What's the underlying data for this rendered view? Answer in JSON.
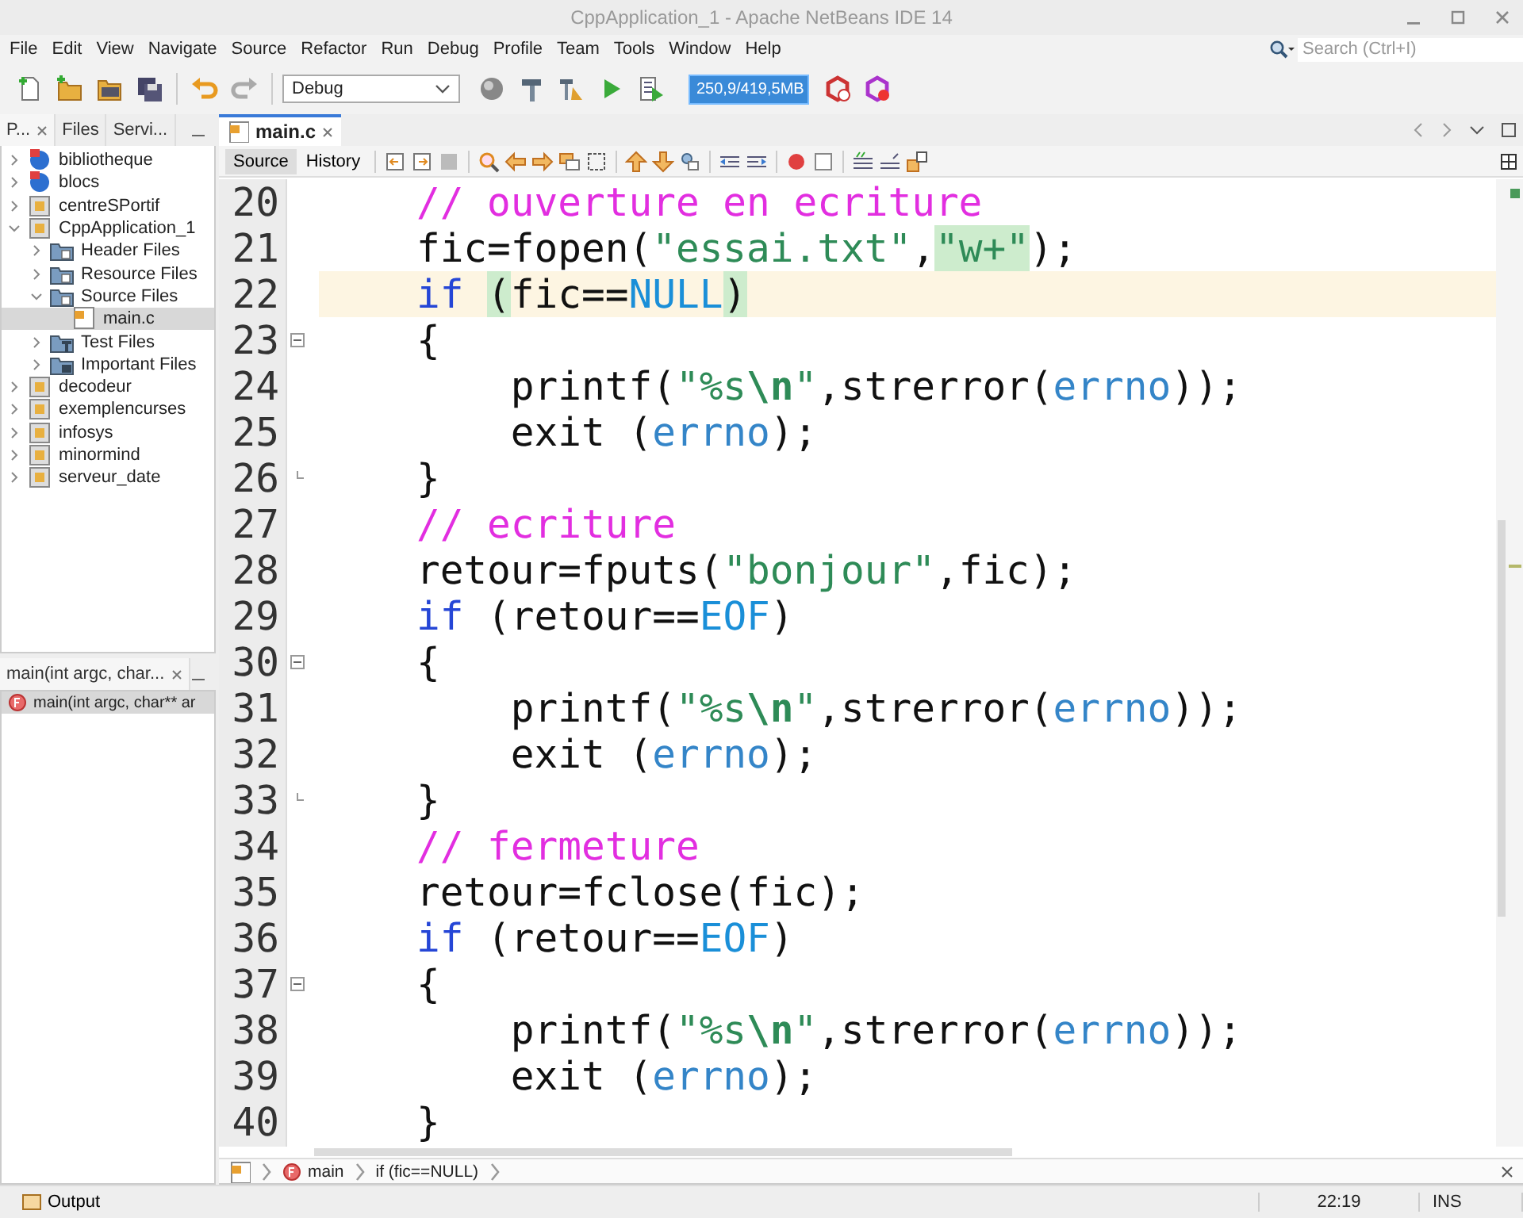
{
  "window": {
    "title": "CppApplication_1 - Apache NetBeans IDE 14"
  },
  "menu": [
    "File",
    "Edit",
    "View",
    "Navigate",
    "Source",
    "Refactor",
    "Run",
    "Debug",
    "Profile",
    "Team",
    "Tools",
    "Window",
    "Help"
  ],
  "search": {
    "placeholder": "Search (Ctrl+I)"
  },
  "toolbar": {
    "configuration": "Debug",
    "memory": "250,9/419,5MB"
  },
  "projects_panel": {
    "tabs": [
      {
        "label": "P...",
        "selected": true
      },
      {
        "label": "Files",
        "selected": false
      },
      {
        "label": "Servi...",
        "selected": false
      }
    ],
    "tree": [
      {
        "label": "bibliotheque",
        "kind": "library",
        "expanded": false,
        "selected": false
      },
      {
        "label": "blocs",
        "kind": "library",
        "expanded": false,
        "selected": false
      },
      {
        "label": "centreSPortif",
        "kind": "project",
        "expanded": false,
        "selected": false
      },
      {
        "label": "CppApplication_1",
        "kind": "project",
        "expanded": true,
        "selected": false,
        "children": [
          {
            "label": "Header Files",
            "kind": "folder",
            "expanded": false,
            "selected": false
          },
          {
            "label": "Resource Files",
            "kind": "folder",
            "expanded": false,
            "selected": false
          },
          {
            "label": "Source Files",
            "kind": "folder",
            "expanded": true,
            "selected": false,
            "children": [
              {
                "label": "main.c",
                "kind": "file",
                "selected": true
              }
            ]
          },
          {
            "label": "Test Files",
            "kind": "testfolder",
            "expanded": false,
            "selected": false
          },
          {
            "label": "Important Files",
            "kind": "importantfolder",
            "expanded": false,
            "selected": false
          }
        ]
      },
      {
        "label": "decodeur",
        "kind": "project",
        "expanded": false,
        "selected": false
      },
      {
        "label": "exemplencurses",
        "kind": "project",
        "expanded": false,
        "selected": false
      },
      {
        "label": "infosys",
        "kind": "project",
        "expanded": false,
        "selected": false
      },
      {
        "label": "minormind",
        "kind": "project",
        "expanded": false,
        "selected": false
      },
      {
        "label": "serveur_date",
        "kind": "project",
        "expanded": false,
        "selected": false
      }
    ]
  },
  "navigator": {
    "tab": "main(int argc, char...",
    "items": [
      {
        "label": "main(int argc, char** ar",
        "selected": true
      }
    ]
  },
  "editor": {
    "tabs": [
      {
        "label": "main.c",
        "selected": true
      }
    ],
    "view_tabs": [
      {
        "label": "Source",
        "selected": true
      },
      {
        "label": "History",
        "selected": false
      }
    ],
    "lines": [
      {
        "number": "20",
        "current": false,
        "kind": "code",
        "tokens": [
          {
            "text": "    // ouverture en ecriture",
            "kind": "comment"
          }
        ]
      },
      {
        "number": "21",
        "current": false,
        "kind": "code",
        "tokens": [
          {
            "text": "    fic=fopen(",
            "kind": "plain"
          },
          {
            "text": "\"essai.txt\"",
            "kind": "string"
          },
          {
            "text": ",",
            "kind": "plain"
          },
          {
            "text": "\"w+\"",
            "kind": "string",
            "highlight": true
          },
          {
            "text": ");",
            "kind": "plain"
          }
        ]
      },
      {
        "number": "22",
        "current": true,
        "kind": "code",
        "tokens": [
          {
            "text": "    if ",
            "kind": "keyword"
          },
          {
            "text": "(",
            "kind": "plain",
            "highlight": true
          },
          {
            "text": "fic==",
            "kind": "plain"
          },
          {
            "text": "NULL",
            "kind": "constant"
          },
          {
            "text": ")",
            "kind": "plain",
            "highlight": true
          }
        ]
      },
      {
        "number": "23",
        "current": false,
        "kind": "fold_start",
        "tokens": [
          {
            "text": "    {",
            "kind": "plain"
          }
        ]
      },
      {
        "number": "24",
        "current": false,
        "kind": "code",
        "tokens": [
          {
            "text": "        printf(",
            "kind": "plain"
          },
          {
            "text": "\"%s",
            "kind": "string"
          },
          {
            "text": "\\n",
            "kind": "escape"
          },
          {
            "text": "\"",
            "kind": "string"
          },
          {
            "text": ",strerror(",
            "kind": "plain"
          },
          {
            "text": "errno",
            "kind": "global"
          },
          {
            "text": "));",
            "kind": "plain"
          }
        ]
      },
      {
        "number": "25",
        "current": false,
        "kind": "code",
        "tokens": [
          {
            "text": "        exit (",
            "kind": "plain"
          },
          {
            "text": "errno",
            "kind": "global"
          },
          {
            "text": ");",
            "kind": "plain"
          }
        ]
      },
      {
        "number": "26",
        "current": false,
        "kind": "fold_end",
        "tokens": [
          {
            "text": "    }",
            "kind": "plain"
          }
        ]
      },
      {
        "number": "27",
        "current": false,
        "kind": "code",
        "tokens": [
          {
            "text": "    // ecriture",
            "kind": "comment"
          }
        ]
      },
      {
        "number": "28",
        "current": false,
        "kind": "code",
        "tokens": [
          {
            "text": "    retour=fputs(",
            "kind": "plain"
          },
          {
            "text": "\"bonjour\"",
            "kind": "string"
          },
          {
            "text": ",fic);",
            "kind": "plain"
          }
        ]
      },
      {
        "number": "29",
        "current": false,
        "kind": "code",
        "tokens": [
          {
            "text": "    if",
            "kind": "keyword"
          },
          {
            "text": " (retour==",
            "kind": "plain"
          },
          {
            "text": "EOF",
            "kind": "constant"
          },
          {
            "text": ")",
            "kind": "plain"
          }
        ]
      },
      {
        "number": "30",
        "current": false,
        "kind": "fold_start",
        "tokens": [
          {
            "text": "    {",
            "kind": "plain"
          }
        ]
      },
      {
        "number": "31",
        "current": false,
        "kind": "code",
        "tokens": [
          {
            "text": "        printf(",
            "kind": "plain"
          },
          {
            "text": "\"%s",
            "kind": "string"
          },
          {
            "text": "\\n",
            "kind": "escape"
          },
          {
            "text": "\"",
            "kind": "string"
          },
          {
            "text": ",strerror(",
            "kind": "plain"
          },
          {
            "text": "errno",
            "kind": "global"
          },
          {
            "text": "));",
            "kind": "plain"
          }
        ]
      },
      {
        "number": "32",
        "current": false,
        "kind": "code",
        "tokens": [
          {
            "text": "        exit (",
            "kind": "plain"
          },
          {
            "text": "errno",
            "kind": "global"
          },
          {
            "text": ");",
            "kind": "plain"
          }
        ]
      },
      {
        "number": "33",
        "current": false,
        "kind": "fold_end",
        "tokens": [
          {
            "text": "    }",
            "kind": "plain"
          }
        ]
      },
      {
        "number": "34",
        "current": false,
        "kind": "code",
        "tokens": [
          {
            "text": "    // fermeture",
            "kind": "comment"
          }
        ]
      },
      {
        "number": "35",
        "current": false,
        "kind": "code",
        "tokens": [
          {
            "text": "    retour=fclose(fic);",
            "kind": "plain"
          }
        ]
      },
      {
        "number": "36",
        "current": false,
        "kind": "code",
        "tokens": [
          {
            "text": "    if",
            "kind": "keyword"
          },
          {
            "text": " (retour==",
            "kind": "plain"
          },
          {
            "text": "EOF",
            "kind": "constant"
          },
          {
            "text": ")",
            "kind": "plain"
          }
        ]
      },
      {
        "number": "37",
        "current": false,
        "kind": "fold_start",
        "tokens": [
          {
            "text": "    {",
            "kind": "plain"
          }
        ]
      },
      {
        "number": "38",
        "current": false,
        "kind": "code",
        "tokens": [
          {
            "text": "        printf(",
            "kind": "plain"
          },
          {
            "text": "\"%s",
            "kind": "string"
          },
          {
            "text": "\\n",
            "kind": "escape"
          },
          {
            "text": "\"",
            "kind": "string"
          },
          {
            "text": ",strerror(",
            "kind": "plain"
          },
          {
            "text": "errno",
            "kind": "global"
          },
          {
            "text": "));",
            "kind": "plain"
          }
        ]
      },
      {
        "number": "39",
        "current": false,
        "kind": "code",
        "tokens": [
          {
            "text": "        exit (",
            "kind": "plain"
          },
          {
            "text": "errno",
            "kind": "global"
          },
          {
            "text": ");",
            "kind": "plain"
          }
        ]
      },
      {
        "number": "40",
        "current": false,
        "kind": "code",
        "tokens": [
          {
            "text": "    }",
            "kind": "plain"
          }
        ]
      }
    ]
  },
  "breadcrumb": [
    "main",
    "if (fic==NULL)"
  ],
  "status_bar": {
    "output": "Output",
    "position": "22:19",
    "mode": "INS"
  }
}
